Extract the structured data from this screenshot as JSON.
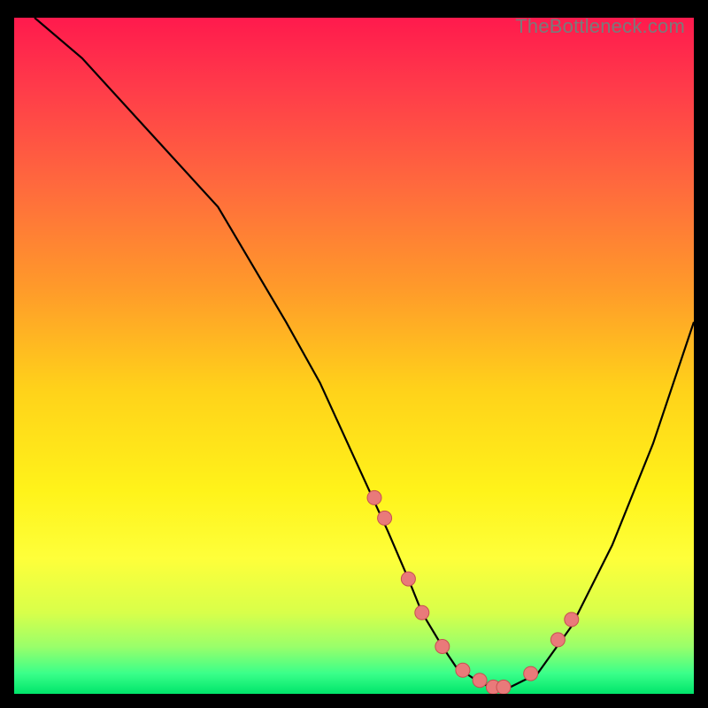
{
  "watermark": "TheBottleneck.com",
  "chart_data": {
    "type": "line",
    "title": "",
    "xlabel": "",
    "ylabel": "",
    "xlim": [
      0,
      100
    ],
    "ylim": [
      0,
      100
    ],
    "curve": {
      "x": [
        3,
        10,
        20,
        30,
        40,
        45,
        50,
        55,
        58,
        60,
        63,
        65,
        68,
        70,
        73,
        77,
        82,
        88,
        94,
        100
      ],
      "y": [
        100,
        94,
        83,
        72,
        55,
        46,
        35,
        24,
        17,
        12,
        7,
        4,
        2,
        1,
        1,
        3,
        10,
        22,
        37,
        55
      ]
    },
    "markers": {
      "x": [
        53,
        54.5,
        58,
        60,
        63,
        66,
        68.5,
        70.5,
        72,
        76,
        80,
        82
      ],
      "y": [
        29,
        26,
        17,
        12,
        7,
        3.5,
        2,
        1,
        1,
        3,
        8,
        11
      ]
    },
    "gradient_stops": [
      {
        "pos": 0,
        "color": "#ff1a4d"
      },
      {
        "pos": 10,
        "color": "#ff3a4a"
      },
      {
        "pos": 25,
        "color": "#ff6a3d"
      },
      {
        "pos": 40,
        "color": "#ff9a2a"
      },
      {
        "pos": 55,
        "color": "#ffd21a"
      },
      {
        "pos": 70,
        "color": "#fff31a"
      },
      {
        "pos": 80,
        "color": "#feff3a"
      },
      {
        "pos": 88,
        "color": "#d8ff4a"
      },
      {
        "pos": 93,
        "color": "#9aff6a"
      },
      {
        "pos": 97,
        "color": "#3aff8a"
      },
      {
        "pos": 100,
        "color": "#00e56a"
      }
    ],
    "marker_style": {
      "fill": "#e97a7a",
      "stroke": "#c65050",
      "r": 8
    }
  }
}
